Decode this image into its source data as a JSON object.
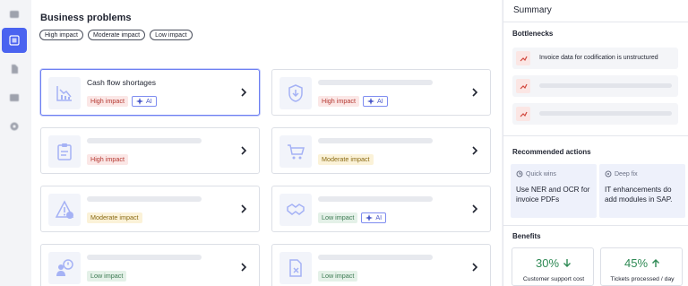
{
  "main": {
    "title": "Business problems",
    "filters": [
      "High impact",
      "Moderate impact",
      "Low impact"
    ],
    "cards": [
      {
        "title": "Cash flow shortages",
        "impact": "High impact",
        "ai": "AI"
      },
      {
        "title": "",
        "impact": "High impact",
        "ai": "AI"
      },
      {
        "title": "",
        "impact": "High impact",
        "ai": ""
      },
      {
        "title": "",
        "impact": "Moderate impact",
        "ai": ""
      },
      {
        "title": "",
        "impact": "Moderate impact",
        "ai": ""
      },
      {
        "title": "",
        "impact": "Low impact",
        "ai": "AI"
      },
      {
        "title": "",
        "impact": "Low impact",
        "ai": ""
      },
      {
        "title": "",
        "impact": "Low impact",
        "ai": ""
      }
    ]
  },
  "summary": {
    "title": "Summary",
    "bottlenecks_title": "Bottlenecks",
    "bottleneck_1": "Invoice data for codification is unstructured",
    "actions_title": "Recommended actions",
    "action_quick_label": "Quick wins",
    "action_quick_text": "Use NER and OCR for invoice PDFs",
    "action_deep_label": "Deep fix",
    "action_deep_text": "IT enhancements do add modules in SAP.",
    "benefits_title": "Benefits",
    "benefit_1_value": "30%",
    "benefit_1_label": "Customer support cost",
    "benefit_2_value": "45%",
    "benefit_2_label": "Tickets processed / day"
  },
  "colors": {
    "accent": "#4a63f0",
    "high": "#b4362f",
    "moderate": "#8a6a14",
    "low": "#3c7a52",
    "positive": "#2f8a55"
  },
  "icons": {
    "rail": [
      "inbox-icon",
      "grid-icon",
      "document-icon",
      "image-icon",
      "settings-icon"
    ],
    "cards": [
      "declining-chart-icon",
      "downward-shield-icon",
      "clipboard-icon",
      "cart-icon",
      "warning-dollar-icon",
      "handshake-icon",
      "users-alert-icon",
      "document-x-icon"
    ]
  }
}
